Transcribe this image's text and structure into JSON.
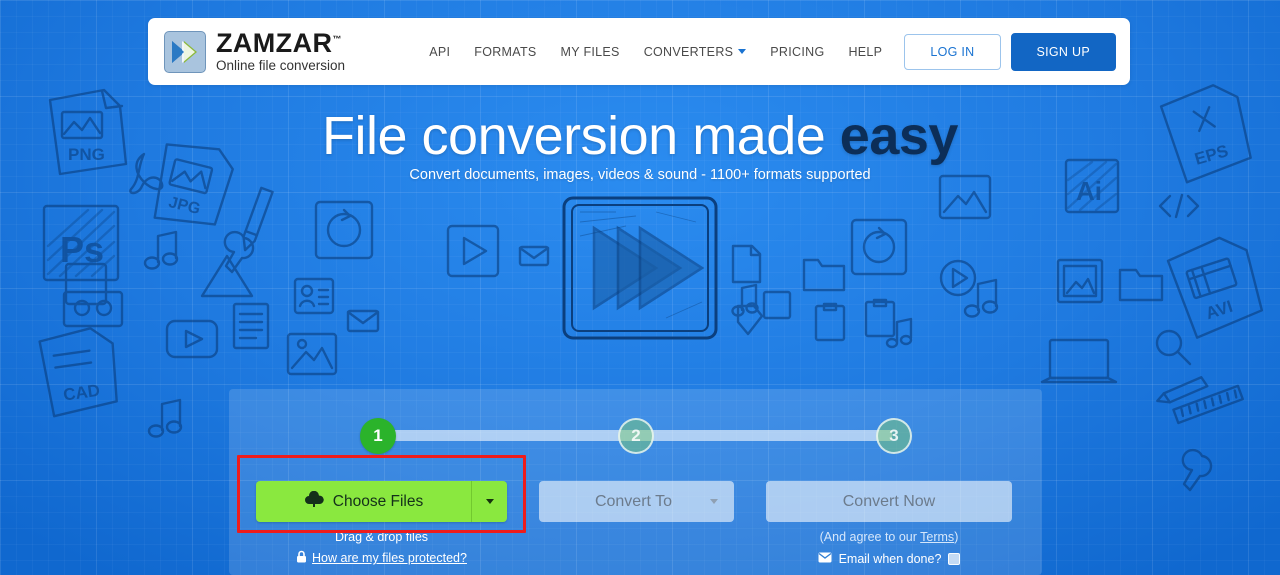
{
  "header": {
    "logo": {
      "icon": "zamzar-chevrons-logo-icon",
      "brand": "ZAMZAR",
      "tm": "™",
      "tagline": "Online file conversion"
    },
    "nav": [
      {
        "label": "API",
        "name": "nav-api",
        "caret": false
      },
      {
        "label": "FORMATS",
        "name": "nav-formats",
        "caret": false
      },
      {
        "label": "MY FILES",
        "name": "nav-my-files",
        "caret": false
      },
      {
        "label": "CONVERTERS",
        "name": "nav-converters",
        "caret": true
      },
      {
        "label": "PRICING",
        "name": "nav-pricing",
        "caret": false
      },
      {
        "label": "HELP",
        "name": "nav-help",
        "caret": false
      }
    ],
    "login_label": "LOG IN",
    "signup_label": "SIGN UP"
  },
  "hero": {
    "title_light": "File conversion made ",
    "title_bold": "easy",
    "subtitle": "Convert documents, images, videos & sound - 1100+ formats supported",
    "art_icon": "sketch-fast-forward-play-icon"
  },
  "converter": {
    "steps": [
      {
        "number": "1",
        "state": "active"
      },
      {
        "number": "2",
        "state": "idle"
      },
      {
        "number": "3",
        "state": "idle"
      }
    ],
    "choose_files": {
      "label": "Choose Files",
      "icon": "cloud-upload-icon",
      "caret_icon": "chevron-down-icon"
    },
    "convert_to": {
      "label": "Convert To",
      "caret_icon": "chevron-down-icon"
    },
    "convert_now_label": "Convert Now",
    "drag_drop_text": "Drag & drop files",
    "protected": {
      "icon": "lock-icon",
      "link_text": "How are my files protected?"
    },
    "terms": {
      "prefix": "(And agree to our ",
      "link_text": "Terms",
      "suffix": ")"
    },
    "email_when_done": {
      "icon": "envelope-icon",
      "label": "Email when done?",
      "checked": false
    }
  },
  "annotation": {
    "name": "choose-files-highlight-box",
    "color": "#ee1c1c"
  },
  "colors": {
    "background_blue": "#1f7ae0",
    "brand_blue": "#1266c4",
    "accent_green": "#8ae83f",
    "step_active_green": "#2bb32b",
    "highlight_red": "#ee1c1c",
    "panel_overlay": "rgba(255,255,255,0.14)"
  },
  "background_doodles": [
    "PNG",
    "JPG",
    "Ps",
    "CAD",
    "EPS",
    "Ai",
    "AVI"
  ]
}
